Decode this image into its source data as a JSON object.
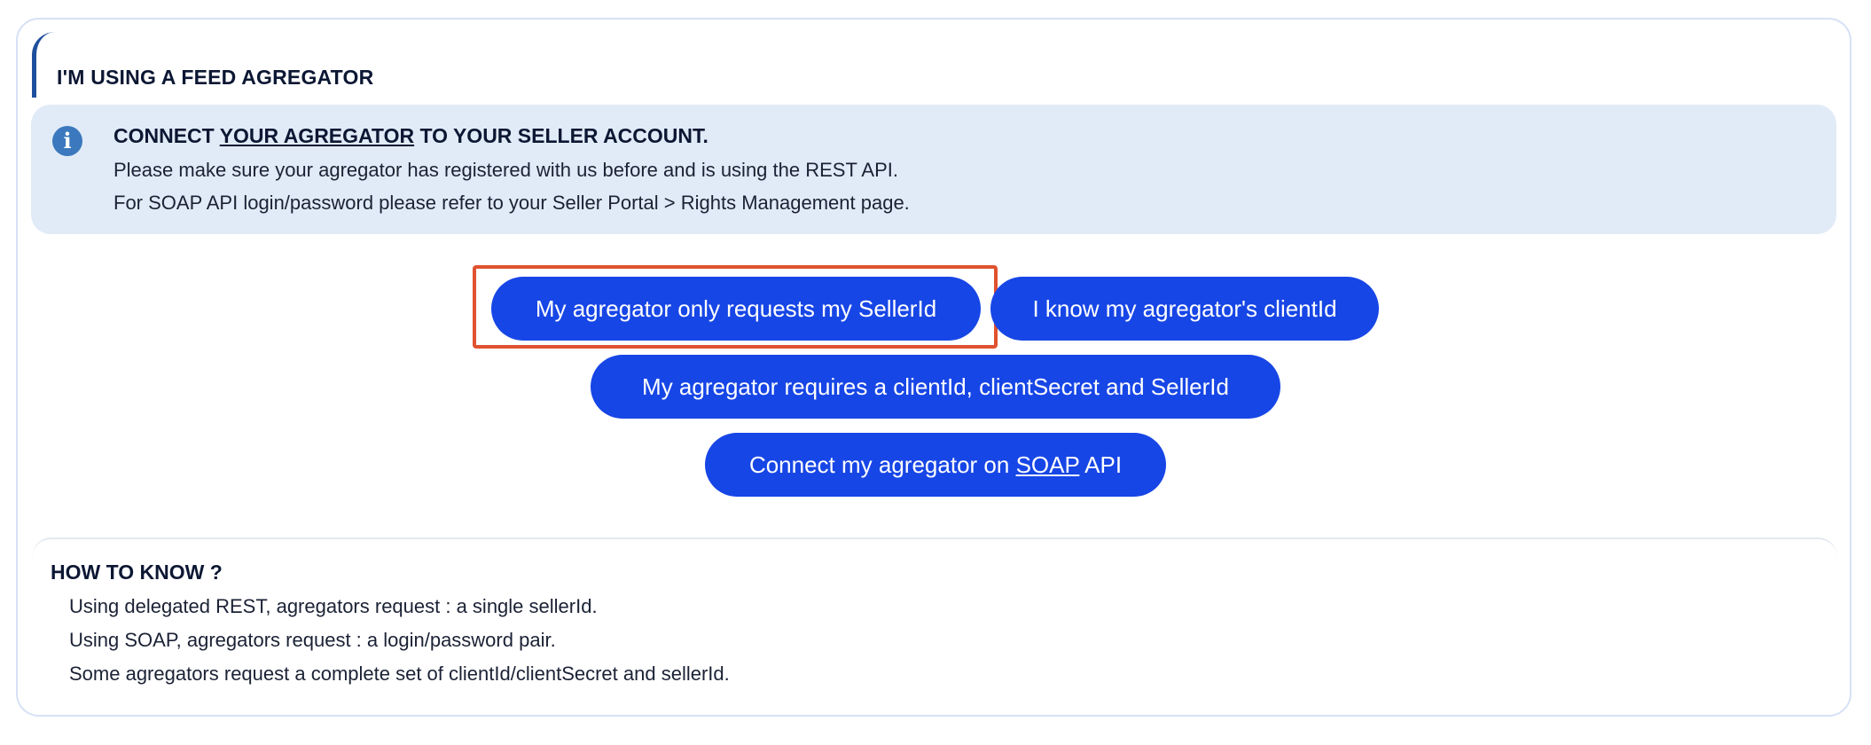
{
  "section": {
    "title": "I'M USING A FEED AGREGATOR"
  },
  "info": {
    "icon": "info-icon",
    "heading_before": "CONNECT ",
    "heading_link": "YOUR AGREGATOR",
    "heading_after": " TO YOUR SELLER ACCOUNT.",
    "line1": "Please make sure your agregator has registered with us before and is using the REST API.",
    "line2": "For SOAP API login/password please refer to your Seller Portal > Rights Management page."
  },
  "buttons": {
    "seller_id_only": "My agregator only requests my SellerId",
    "know_client_id": "I know my agregator's clientId",
    "client_secret_seller": "My agregator requires a clientId, clientSecret and SellerId",
    "soap_before": "Connect my agregator on ",
    "soap_link": "SOAP",
    "soap_after": " API"
  },
  "howto": {
    "title": "HOW TO KNOW ?",
    "line1": "Using delegated REST, agregators request : a single sellerId.",
    "line2": "Using SOAP, agregators request : a login/password pair.",
    "line3": "Some agregators request a complete set of clientId/clientSecret and sellerId."
  },
  "colors": {
    "button": "#1746e6",
    "info_background": "#e1ebf7",
    "highlight": "#e0522f",
    "accent": "#1e4f9c"
  }
}
